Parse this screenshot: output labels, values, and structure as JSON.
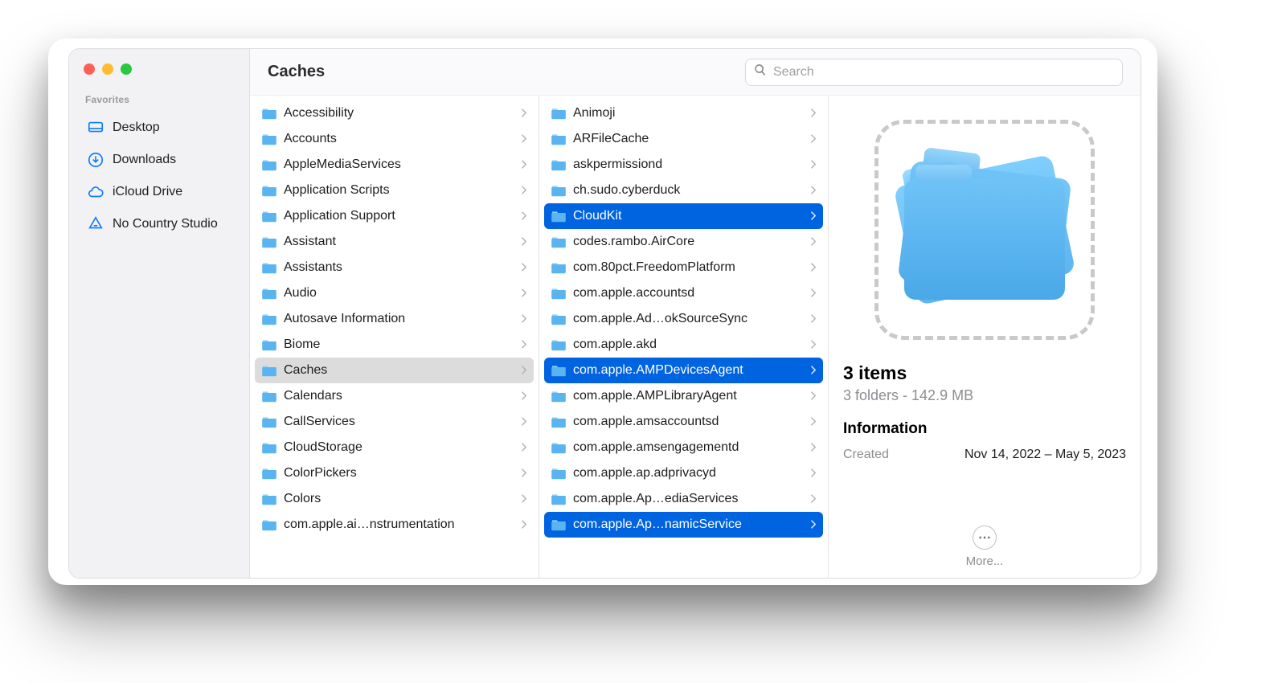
{
  "header": {
    "title": "Caches"
  },
  "search": {
    "placeholder": "Search"
  },
  "sidebar": {
    "section_label": "Favorites",
    "items": [
      {
        "label": "Desktop",
        "icon": "desktop-icon"
      },
      {
        "label": "Downloads",
        "icon": "download-icon"
      },
      {
        "label": "iCloud Drive",
        "icon": "cloud-icon"
      },
      {
        "label": "No Country Studio",
        "icon": "drive-icon"
      }
    ]
  },
  "columns": [
    {
      "active_path": true,
      "items": [
        {
          "label": "Accessibility"
        },
        {
          "label": "Accounts"
        },
        {
          "label": "AppleMediaServices"
        },
        {
          "label": "Application Scripts"
        },
        {
          "label": "Application Support"
        },
        {
          "label": "Assistant"
        },
        {
          "label": "Assistants"
        },
        {
          "label": "Audio"
        },
        {
          "label": "Autosave Information"
        },
        {
          "label": "Biome"
        },
        {
          "label": "Caches",
          "active": true
        },
        {
          "label": "Calendars"
        },
        {
          "label": "CallServices"
        },
        {
          "label": "CloudStorage"
        },
        {
          "label": "ColorPickers"
        },
        {
          "label": "Colors"
        },
        {
          "label": "com.apple.ai…nstrumentation"
        }
      ]
    },
    {
      "items": [
        {
          "label": "Animoji"
        },
        {
          "label": "ARFileCache"
        },
        {
          "label": "askpermissiond"
        },
        {
          "label": "ch.sudo.cyberduck"
        },
        {
          "label": "CloudKit",
          "selected": true
        },
        {
          "label": "codes.rambo.AirCore"
        },
        {
          "label": "com.80pct.FreedomPlatform"
        },
        {
          "label": "com.apple.accountsd"
        },
        {
          "label": "com.apple.Ad…okSourceSync"
        },
        {
          "label": "com.apple.akd"
        },
        {
          "label": "com.apple.AMPDevicesAgent",
          "selected": true
        },
        {
          "label": "com.apple.AMPLibraryAgent"
        },
        {
          "label": "com.apple.amsaccountsd"
        },
        {
          "label": "com.apple.amsengagementd"
        },
        {
          "label": "com.apple.ap.adprivacyd"
        },
        {
          "label": "com.apple.Ap…ediaServices"
        },
        {
          "label": "com.apple.Ap…namicService",
          "selected": true
        }
      ]
    }
  ],
  "preview": {
    "count_title": "3 items",
    "subtitle": "3 folders - 142.9 MB",
    "info_heading": "Information",
    "info_rows": [
      {
        "label": "Created",
        "value": "Nov 14, 2022 – May 5, 2023"
      }
    ],
    "more_label": "More..."
  },
  "colors": {
    "accent": "#0064e1",
    "folder": "#5ab4ef",
    "sidebar_icon": "#0a7aff"
  }
}
